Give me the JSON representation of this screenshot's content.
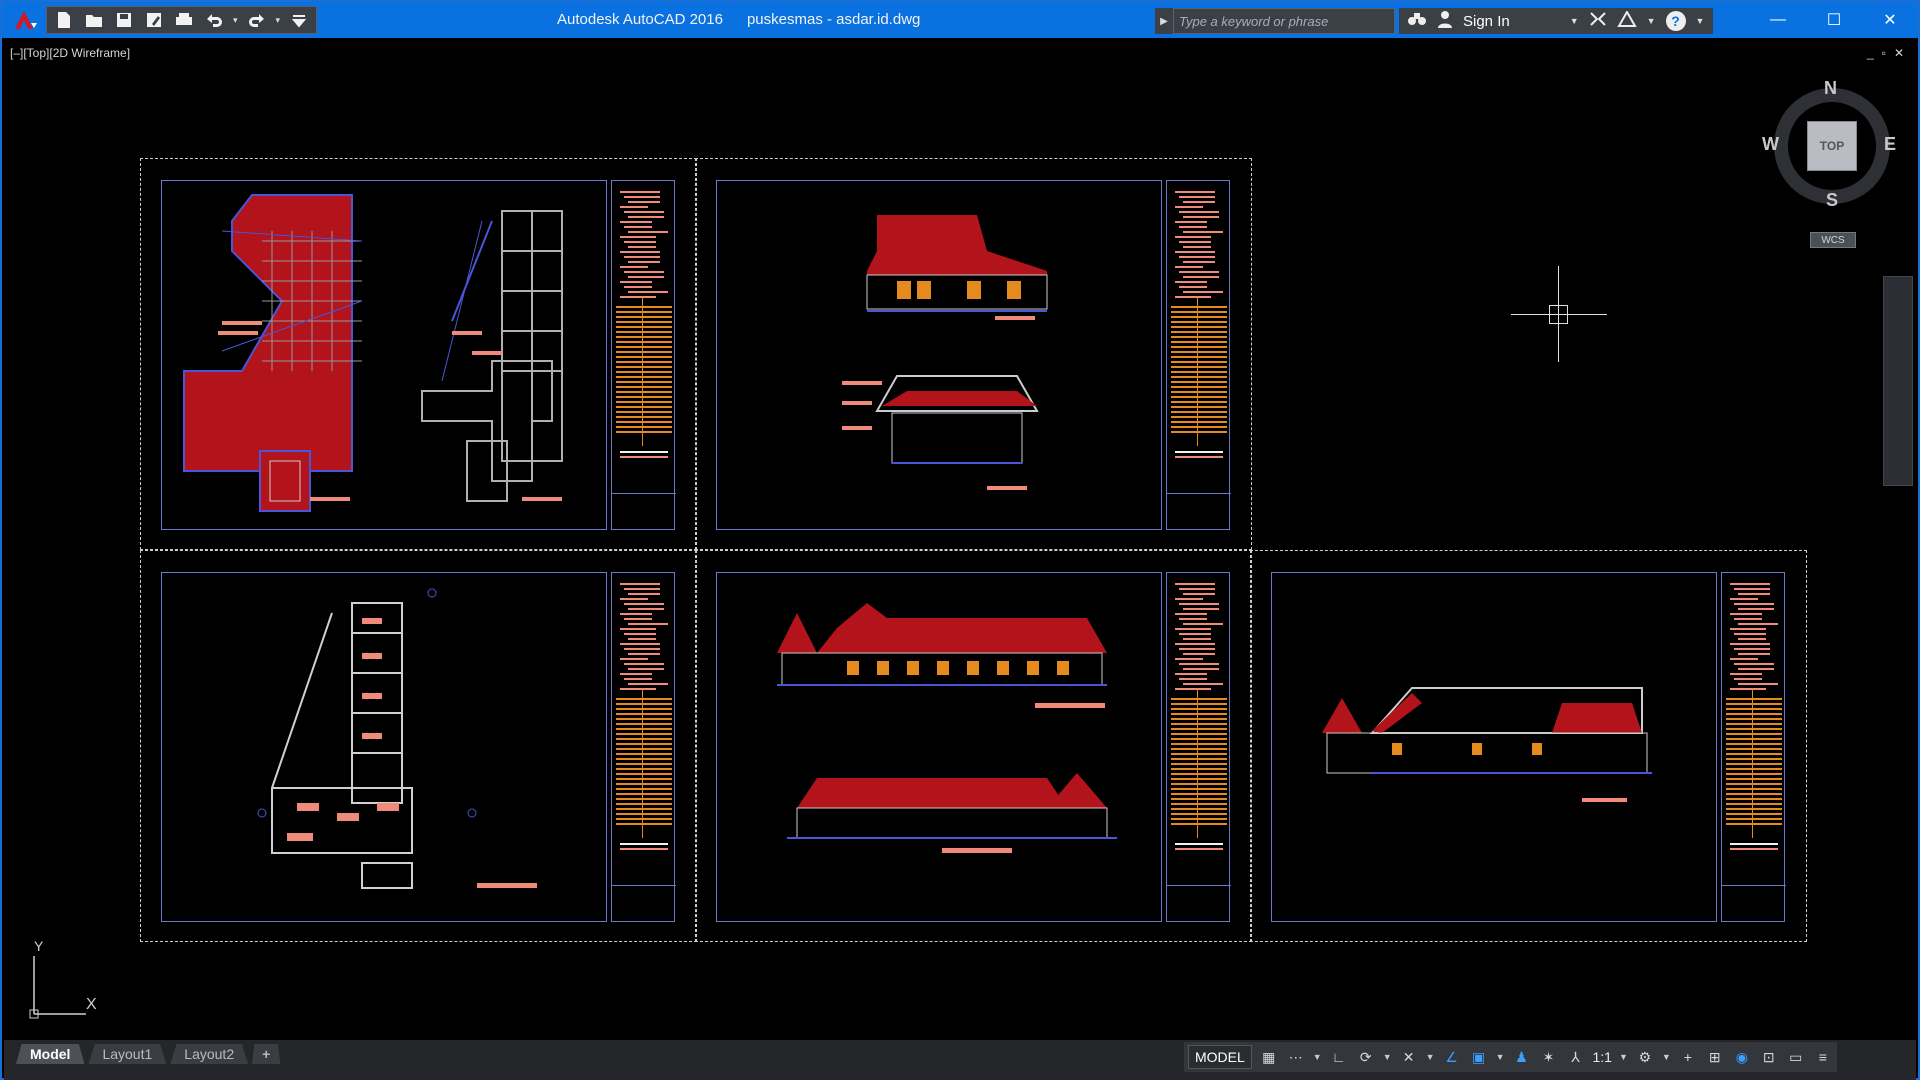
{
  "titlebar": {
    "app_name": "Autodesk AutoCAD 2016",
    "file_name": "puskesmas - asdar.id.dwg",
    "search_placeholder": "Type a keyword or phrase",
    "sign_in": "Sign In",
    "help": "?"
  },
  "quick_access": {
    "icons": [
      "new-icon",
      "open-icon",
      "save-icon",
      "save-as-icon",
      "plot-icon",
      "undo-icon",
      "redo-icon",
      "customize-icon"
    ]
  },
  "window_controls": {
    "minimize": "—",
    "maximize": "☐",
    "close": "✕"
  },
  "viewport": {
    "label": "[–][Top][2D Wireframe]",
    "controls": [
      "_",
      "▫",
      "✕"
    ]
  },
  "viewcube": {
    "top": "TOP",
    "north": "N",
    "south": "S",
    "east": "E",
    "west": "W",
    "wcs": "WCS"
  },
  "ucs": {
    "x": "X",
    "y": "Y"
  },
  "layout_tabs": [
    {
      "label": "Model",
      "active": true
    },
    {
      "label": "Layout1",
      "active": false
    },
    {
      "label": "Layout2",
      "active": false
    },
    {
      "label": "+",
      "active": false
    }
  ],
  "statusbar": {
    "model": "MODEL",
    "scale": "1:1",
    "icons": [
      "grid-icon",
      "snap-icon",
      "ortho-icon",
      "polar-icon",
      "isodraft-icon",
      "osnap-icon",
      "otrack-icon",
      "lineweight-icon",
      "annotation-visibility-icon",
      "autoscale-icon",
      "annotation-scale-icon",
      "workspace-icon",
      "plus-icon",
      "units-icon",
      "quick-properties-icon",
      "hardware-accel-icon",
      "isolate-icon",
      "fullscreen-icon",
      "customize-icon"
    ]
  },
  "colors": {
    "title_bar": "#0a72e0",
    "roof_red": "#b3131a",
    "outline_blue": "#4a55d8",
    "label_salmon": "#f08a7a",
    "titleblock_orange": "#e58a1f"
  }
}
